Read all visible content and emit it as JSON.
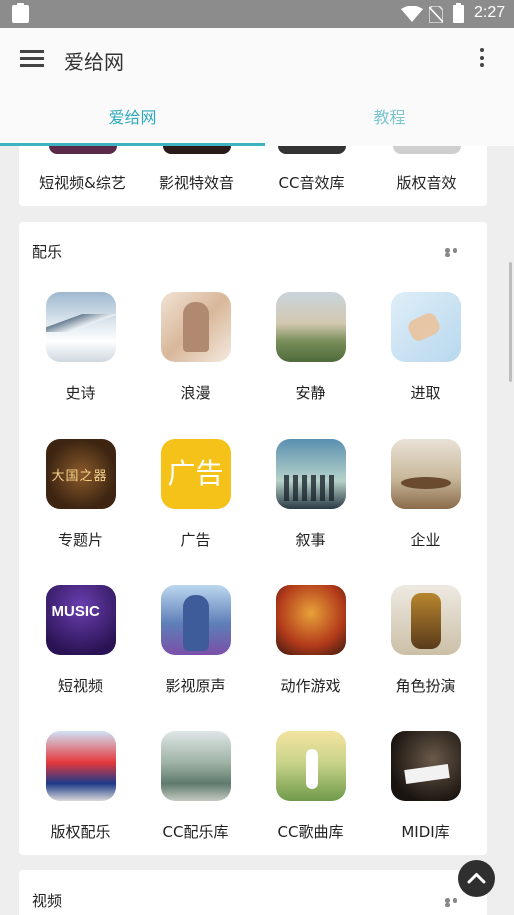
{
  "status_bar": {
    "time": "2:27"
  },
  "app_bar": {
    "title": "爱给网"
  },
  "tabs": [
    {
      "label": "爱给网",
      "active": true
    },
    {
      "label": "教程",
      "active": false
    }
  ],
  "top_row": {
    "items": [
      {
        "label": "短视频&综艺"
      },
      {
        "label": "影视特效音"
      },
      {
        "label": "CC音效库"
      },
      {
        "label": "版权音效"
      }
    ]
  },
  "music_section": {
    "title": "配乐",
    "items": [
      {
        "label": "史诗"
      },
      {
        "label": "浪漫"
      },
      {
        "label": "安静"
      },
      {
        "label": "进取"
      },
      {
        "label": "专题片",
        "thumb_text": "大国之器"
      },
      {
        "label": "广告",
        "thumb_text": "广告"
      },
      {
        "label": "叙事"
      },
      {
        "label": "企业"
      },
      {
        "label": "短视频",
        "thumb_text": "MUSIC"
      },
      {
        "label": "影视原声"
      },
      {
        "label": "动作游戏"
      },
      {
        "label": "角色扮演"
      },
      {
        "label": "版权配乐"
      },
      {
        "label": "CC配乐库"
      },
      {
        "label": "CC歌曲库"
      },
      {
        "label": "MIDI库"
      }
    ]
  },
  "video_section": {
    "title": "视频"
  },
  "colors": {
    "accent": "#3fb2c2",
    "status_bar": "#8c8c8c"
  }
}
